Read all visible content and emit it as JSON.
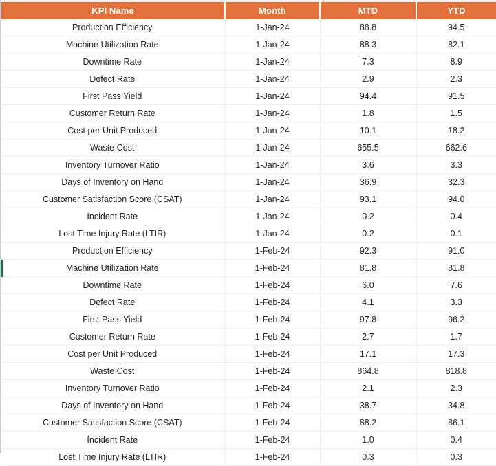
{
  "table": {
    "columns": [
      {
        "key": "kpi",
        "label": "KPI Name"
      },
      {
        "key": "month",
        "label": "Month"
      },
      {
        "key": "mtd",
        "label": "MTD"
      },
      {
        "key": "ytd",
        "label": "YTD"
      }
    ],
    "header_background": "#E2703A",
    "header_text_color": "#FFFFFF",
    "gridline_color": "#F6ECE5",
    "selection_marker_color": "#1E6B4E",
    "selected_row_index": 14,
    "rows": [
      {
        "kpi": "Production Efficiency",
        "month": "1-Jan-24",
        "mtd": "88.8",
        "ytd": "94.5"
      },
      {
        "kpi": "Machine Utilization Rate",
        "month": "1-Jan-24",
        "mtd": "88.3",
        "ytd": "82.1"
      },
      {
        "kpi": "Downtime Rate",
        "month": "1-Jan-24",
        "mtd": "7.3",
        "ytd": "8.9"
      },
      {
        "kpi": "Defect Rate",
        "month": "1-Jan-24",
        "mtd": "2.9",
        "ytd": "2.3"
      },
      {
        "kpi": "First Pass Yield",
        "month": "1-Jan-24",
        "mtd": "94.4",
        "ytd": "91.5"
      },
      {
        "kpi": "Customer Return Rate",
        "month": "1-Jan-24",
        "mtd": "1.8",
        "ytd": "1.5"
      },
      {
        "kpi": "Cost per Unit Produced",
        "month": "1-Jan-24",
        "mtd": "10.1",
        "ytd": "18.2"
      },
      {
        "kpi": "Waste Cost",
        "month": "1-Jan-24",
        "mtd": "655.5",
        "ytd": "662.6"
      },
      {
        "kpi": "Inventory Turnover Ratio",
        "month": "1-Jan-24",
        "mtd": "3.6",
        "ytd": "3.3"
      },
      {
        "kpi": "Days of Inventory on Hand",
        "month": "1-Jan-24",
        "mtd": "36.9",
        "ytd": "32.3"
      },
      {
        "kpi": "Customer Satisfaction Score (CSAT)",
        "month": "1-Jan-24",
        "mtd": "93.1",
        "ytd": "94.0"
      },
      {
        "kpi": "Incident Rate",
        "month": "1-Jan-24",
        "mtd": "0.2",
        "ytd": "0.4"
      },
      {
        "kpi": "Lost Time Injury Rate (LTIR)",
        "month": "1-Jan-24",
        "mtd": "0.2",
        "ytd": "0.1"
      },
      {
        "kpi": "Production Efficiency",
        "month": "1-Feb-24",
        "mtd": "92.3",
        "ytd": "91.0"
      },
      {
        "kpi": "Machine Utilization Rate",
        "month": "1-Feb-24",
        "mtd": "81.8",
        "ytd": "81.8"
      },
      {
        "kpi": "Downtime Rate",
        "month": "1-Feb-24",
        "mtd": "6.0",
        "ytd": "7.6"
      },
      {
        "kpi": "Defect Rate",
        "month": "1-Feb-24",
        "mtd": "4.1",
        "ytd": "3.3"
      },
      {
        "kpi": "First Pass Yield",
        "month": "1-Feb-24",
        "mtd": "97.8",
        "ytd": "96.2"
      },
      {
        "kpi": "Customer Return Rate",
        "month": "1-Feb-24",
        "mtd": "2.7",
        "ytd": "1.7"
      },
      {
        "kpi": "Cost per Unit Produced",
        "month": "1-Feb-24",
        "mtd": "17.1",
        "ytd": "17.3"
      },
      {
        "kpi": "Waste Cost",
        "month": "1-Feb-24",
        "mtd": "864.8",
        "ytd": "818.8"
      },
      {
        "kpi": "Inventory Turnover Ratio",
        "month": "1-Feb-24",
        "mtd": "2.1",
        "ytd": "2.3"
      },
      {
        "kpi": "Days of Inventory on Hand",
        "month": "1-Feb-24",
        "mtd": "38.7",
        "ytd": "34.8"
      },
      {
        "kpi": "Customer Satisfaction Score (CSAT)",
        "month": "1-Feb-24",
        "mtd": "88.2",
        "ytd": "86.1"
      },
      {
        "kpi": "Incident Rate",
        "month": "1-Feb-24",
        "mtd": "1.0",
        "ytd": "0.4"
      },
      {
        "kpi": "Lost Time Injury Rate (LTIR)",
        "month": "1-Feb-24",
        "mtd": "0.3",
        "ytd": "0.3"
      }
    ]
  }
}
